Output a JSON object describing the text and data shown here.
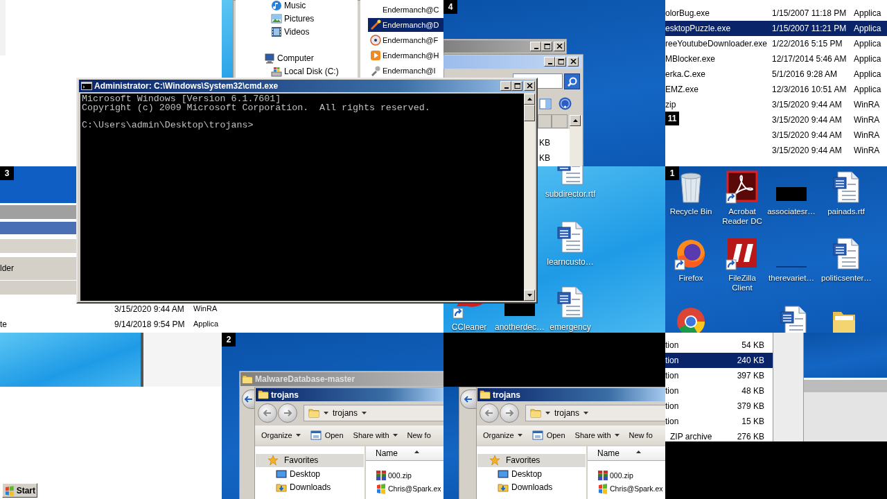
{
  "cmd_window": {
    "title": "Administrator: C:\\Windows\\System32\\cmd.exe",
    "output": [
      "Microsoft Windows [Version 6.1.7601]",
      "Copyright (c) 2009 Microsoft Corporation.  All rights reserved."
    ],
    "prompt": "C:\\Users\\admin\\Desktop\\trojans>"
  },
  "tiles": [
    {
      "kind": "blank"
    },
    {
      "kind": "library_explorer",
      "nav": [
        {
          "label": "Music",
          "kind": "music"
        },
        {
          "label": "Pictures",
          "kind": "pictures"
        },
        {
          "label": "Videos",
          "kind": "videos"
        },
        {
          "label": "Computer",
          "kind": "computer",
          "children": [
            {
              "label": "Local Disk (C:)",
              "kind": "disk"
            }
          ]
        }
      ],
      "files": [
        {
          "name": "Endermanch@C",
          "kind": "none",
          "selected": false
        },
        {
          "name": "Endermanch@D",
          "kind": "wand",
          "selected": true
        },
        {
          "name": "Endermanch@F",
          "kind": "disc",
          "selected": false
        },
        {
          "name": "Endermanch@H",
          "kind": "player",
          "selected": false
        },
        {
          "name": "Endermanch@I",
          "kind": "tool",
          "selected": false
        }
      ]
    },
    {
      "kind": "stacked_windows",
      "number": "4",
      "sizes": [
        "KB",
        "KB"
      ]
    },
    {
      "kind": "details_list",
      "number": "11",
      "rows": [
        {
          "name": "olorBug.exe",
          "date": "1/15/2007 11:18 PM",
          "type": "Applica",
          "selected": false
        },
        {
          "name": "esktopPuzzle.exe",
          "date": "1/15/2007 11:21 PM",
          "type": "Applica",
          "selected": true
        },
        {
          "name": "reeYoutubeDownloader.exe",
          "date": "1/22/2016 5:15 PM",
          "type": "Applica",
          "selected": false
        },
        {
          "name": "MBlocker.exe",
          "date": "12/17/2014 5:46 AM",
          "type": "Applica",
          "selected": false
        },
        {
          "name": "erka.C.exe",
          "date": "5/1/2016 9:28 AM",
          "type": "Applica",
          "selected": false
        },
        {
          "name": "EMZ.exe",
          "date": "12/3/2016 10:51 AM",
          "type": "Applica",
          "selected": false
        },
        {
          "name": "zip",
          "date": "3/15/2020 9:44 AM",
          "type": "WinRA",
          "selected": false
        },
        {
          "date": "3/15/2020 9:44 AM",
          "type": "WinRA",
          "selected": false
        },
        {
          "date": "3/15/2020 9:44 AM",
          "type": "WinRA",
          "selected": false
        },
        {
          "date": "3/15/2020 9:44 AM",
          "type": "WinRA",
          "selected": false
        }
      ]
    },
    {
      "kind": "strip_panel",
      "number": "3",
      "label": "lder",
      "rows": [
        {
          "date": "3/15/2020 9:44 AM",
          "type": "WinRA"
        },
        {
          "name": "te",
          "date": "9/14/2018 9:54 PM",
          "type": "Applica"
        }
      ]
    },
    {
      "kind": "blank"
    },
    {
      "kind": "light_desktop",
      "icons": [
        {
          "label": "subdirector.rtf",
          "kind": "document"
        },
        {
          "label": "learncusto…",
          "kind": "document"
        },
        {
          "label": "CCleaner",
          "kind": "cleaner"
        },
        {
          "label": "anotherdec…",
          "kind": "hidden"
        },
        {
          "label": "emergency",
          "kind": "document"
        }
      ]
    },
    {
      "kind": "dark_desktop",
      "number": "1",
      "icons": [
        {
          "label": "Recycle Bin",
          "kind": "recycle_bin"
        },
        {
          "label": "Acrobat Reader DC",
          "kind": "acrobat"
        },
        {
          "label": "associatesr…",
          "kind": "hidden"
        },
        {
          "label": "painads.rtf",
          "kind": "document"
        },
        {
          "label": "Firefox",
          "kind": "firefox"
        },
        {
          "label": "FileZilla Client",
          "kind": "filezilla"
        },
        {
          "label": "therevariet…",
          "kind": "blank"
        },
        {
          "label": "politicsenter…",
          "kind": "document"
        },
        {
          "kind": "chrome"
        },
        {
          "kind": "document"
        },
        {
          "kind": "folder"
        }
      ]
    },
    {
      "kind": "split_desktop",
      "start_button": "Start"
    },
    {
      "kind": "explorer_over_blue",
      "number": "2",
      "behind_title": "MalwareDatabase-master",
      "window": {
        "title": "trojans",
        "path": "trojans",
        "toolbar": [
          {
            "label": "Organize",
            "kind": "menu"
          },
          {
            "label": "Open",
            "kind": "open"
          },
          {
            "label": "Share with",
            "kind": "menu"
          },
          {
            "label": "New fo",
            "kind": "plain"
          }
        ],
        "nav": [
          {
            "label": "Favorites",
            "kind": "star",
            "children": [
              {
                "label": "Desktop",
                "kind": "desktop"
              },
              {
                "label": "Downloads",
                "kind": "downloads"
              }
            ]
          }
        ],
        "column": "Name",
        "files": [
          {
            "name": "000.zip",
            "kind": "archive"
          },
          {
            "name": "Chris@Spark.ex",
            "kind": "program"
          }
        ]
      }
    },
    {
      "kind": "explorer_over_black",
      "window": {
        "title": "trojans",
        "path": "trojans",
        "toolbar": [
          {
            "label": "Organize",
            "kind": "menu"
          },
          {
            "label": "Open",
            "kind": "open"
          },
          {
            "label": "Share with",
            "kind": "menu"
          },
          {
            "label": "New fo",
            "kind": "plain"
          }
        ],
        "nav": [
          {
            "label": "Favorites",
            "kind": "star",
            "children": [
              {
                "label": "Desktop",
                "kind": "desktop"
              },
              {
                "label": "Downloads",
                "kind": "downloads"
              }
            ]
          }
        ],
        "column": "Name",
        "files": [
          {
            "name": "000.zip",
            "kind": "archive"
          },
          {
            "name": "Chris@Spark.ex",
            "kind": "program"
          }
        ]
      }
    },
    {
      "kind": "size_list",
      "rows": [
        {
          "type": "tion",
          "size": "54 KB",
          "selected": false
        },
        {
          "type": "tion",
          "size": "240 KB",
          "selected": true
        },
        {
          "type": "tion",
          "size": "397 KB",
          "selected": false
        },
        {
          "type": "tion",
          "size": "48 KB",
          "selected": false
        },
        {
          "type": "tion",
          "size": "379 KB",
          "selected": false
        },
        {
          "type": "tion",
          "size": "15 KB",
          "selected": false
        },
        {
          "type": "ZIP archive",
          "size": "276 KB",
          "selected": false
        }
      ]
    }
  ]
}
